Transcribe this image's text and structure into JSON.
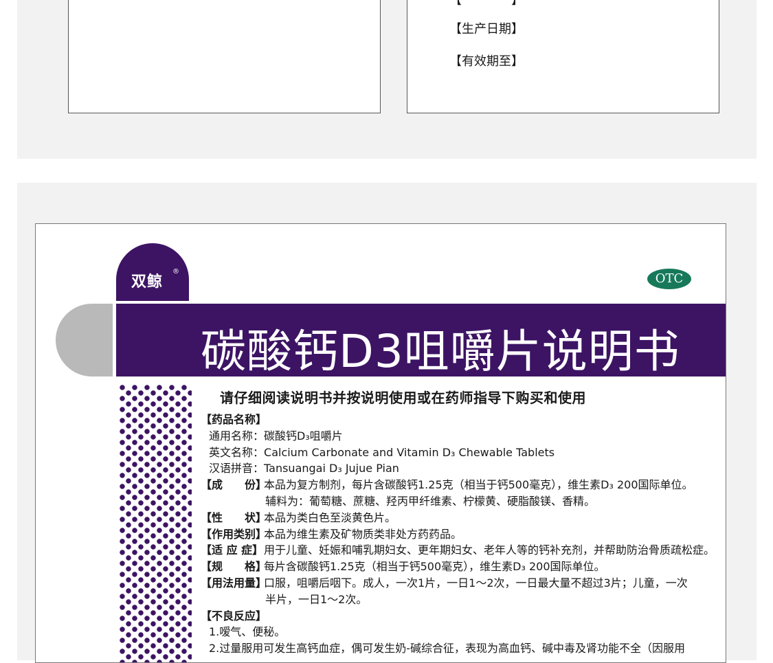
{
  "top_panel": {
    "partial_line": "【　　　　】",
    "production_date": "【生产日期】",
    "expiry_date": "【有效期至】"
  },
  "header": {
    "brand": "双鲸",
    "registered": "®",
    "otc_badge": "OTC",
    "title": "碳酸钙D3咀嚼片说明书"
  },
  "warning": "请仔细阅读说明书并按说明使用或在药师指导下购买和使用",
  "drug_name": {
    "section": "【药品名称】",
    "generic_label": "通用名称：",
    "generic_value": "碳酸钙D₃咀嚼片",
    "english_label": "英文名称：",
    "english_value": "Calcium Carbonate and Vitamin D₃ Chewable Tablets",
    "pinyin_label": "汉语拼音：",
    "pinyin_value": "Tansuangai D₃ Jujue Pian"
  },
  "composition": {
    "label": "【成　　份】",
    "line1": "本品为复方制剂，每片含碳酸钙1.25克（相当于钙500毫克），维生素D₃ 200国际单位。",
    "line2": "辅料为：葡萄糖、蔗糖、羟丙甲纤维素、柠檬黄、硬脂酸镁、香精。"
  },
  "properties": {
    "label": "【性　　状】",
    "text": "本品为类白色至淡黄色片。"
  },
  "category": {
    "label": "【作用类别】",
    "text": "本品为维生素及矿物质类非处方药药品。"
  },
  "indications": {
    "label": "【适 应 症】",
    "text": "用于儿童、妊娠和哺乳期妇女、更年期妇女、老年人等的钙补充剂，并帮助防治骨质疏松症。"
  },
  "specification": {
    "label": "【规　　格】",
    "text": "每片含碳酸钙1.25克（相当于钙500毫克），维生素D₃ 200国际单位。"
  },
  "dosage": {
    "label": "【用法用量】",
    "line1": "口服，咀嚼后咽下。成人，一次1片，一日1～2次，一日最大量不超过3片；儿童，一次",
    "line2": "半片，一日1～2次。"
  },
  "adverse": {
    "section": "【不良反应】",
    "item1": "1.嗳气、便秘。",
    "item2": "2.过量服用可发生高钙血症，偶可发生奶-碱综合征，表现为高血钙、碱中毒及肾功能不全（因服用"
  },
  "colors": {
    "purple": "#3d1464",
    "otc_green": "#17795a",
    "gray": "#b9b9b9",
    "panel_bg": "#f2f2f2"
  }
}
